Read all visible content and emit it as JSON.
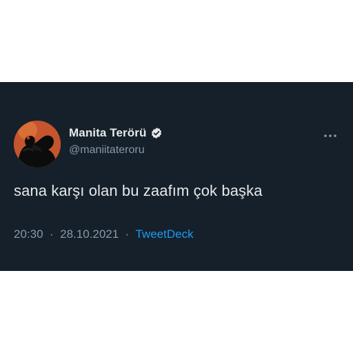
{
  "tweet": {
    "display_name": "Manita Terörü",
    "handle": "@maniitateroru",
    "text": "sana karşı olan bu zaafım çok başka",
    "time": "20:30",
    "separator": "·",
    "date": "28.10.2021",
    "source": "TweetDeck",
    "verified": true
  },
  "icons": {
    "verified": "verified-badge-icon",
    "more": "more-options-icon"
  },
  "colors": {
    "background": "#15202b",
    "primary_text": "#e7e9ea",
    "secondary_text": "#8b98a5",
    "link": "#1d9bf0",
    "page": "#ffffff"
  }
}
